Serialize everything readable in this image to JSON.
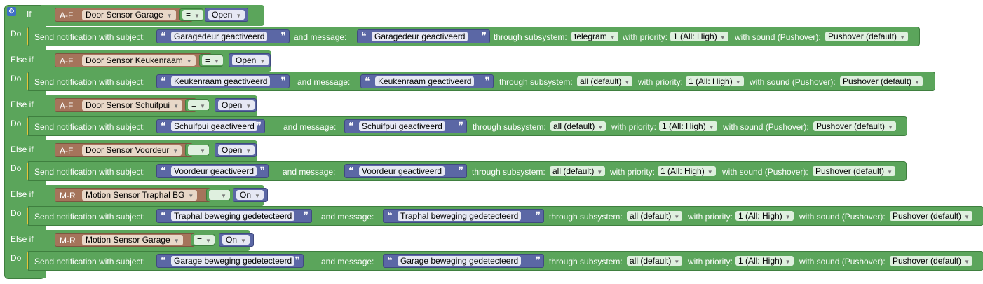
{
  "keywords": {
    "if": "If",
    "do": "Do",
    "else_if": "Else if"
  },
  "send_label": "Send notification with subject:",
  "message_label": "and message:",
  "subsystem_label": "through subsystem:",
  "priority_label": "with priority:",
  "sound_label": "with sound (Pushover):",
  "blocks": [
    {
      "prefix": "A-F",
      "device": "Door Sensor Garage",
      "op": "=",
      "state": "Open",
      "subject": "Garagedeur geactiveerd",
      "message": "Garagedeur geactiveerd",
      "subsystem": "telegram",
      "priority": "1 (All: High)",
      "sound": "Pushover (default)"
    },
    {
      "prefix": "A-F",
      "device": "Door Sensor Keukenraam",
      "op": "=",
      "state": "Open",
      "subject": "Keukenraam geactiveerd",
      "message": "Keukenraam geactiveerd",
      "subsystem": "all (default)",
      "priority": "1 (All: High)",
      "sound": "Pushover (default)"
    },
    {
      "prefix": "A-F",
      "device": "Door Sensor Schuifpui",
      "op": "=",
      "state": "Open",
      "subject": "Schuifpui geactiveerd",
      "message": "Schuifpui geactiveerd",
      "subsystem": "all (default)",
      "priority": "1 (All: High)",
      "sound": "Pushover (default)"
    },
    {
      "prefix": "A-F",
      "device": "Door Sensor Voordeur",
      "op": "=",
      "state": "Open",
      "subject": "Voordeur geactiveerd",
      "message": "Voordeur geactiveerd",
      "subsystem": "all (default)",
      "priority": "1 (All: High)",
      "sound": "Pushover (default)"
    },
    {
      "prefix": "M-R",
      "device": "Motion Sensor Traphal BG",
      "op": "=",
      "state": "On",
      "subject": "Traphal beweging gedetecteerd",
      "message": "Traphal beweging gedetecteerd",
      "subsystem": "all (default)",
      "priority": "1 (All: High)",
      "sound": "Pushover (default)"
    },
    {
      "prefix": "M-R",
      "device": "Motion Sensor Garage",
      "op": "=",
      "state": "On",
      "subject": "Garage beweging gedetecteerd",
      "message": "Garage beweging gedetecteerd",
      "subsystem": "all (default)",
      "priority": "1 (All: High)",
      "sound": "Pushover (default)"
    }
  ],
  "colors": {
    "logic": "#5ba55b",
    "device": "#a5745b",
    "value": "#5b67a5",
    "slot": "#e8c33a"
  }
}
